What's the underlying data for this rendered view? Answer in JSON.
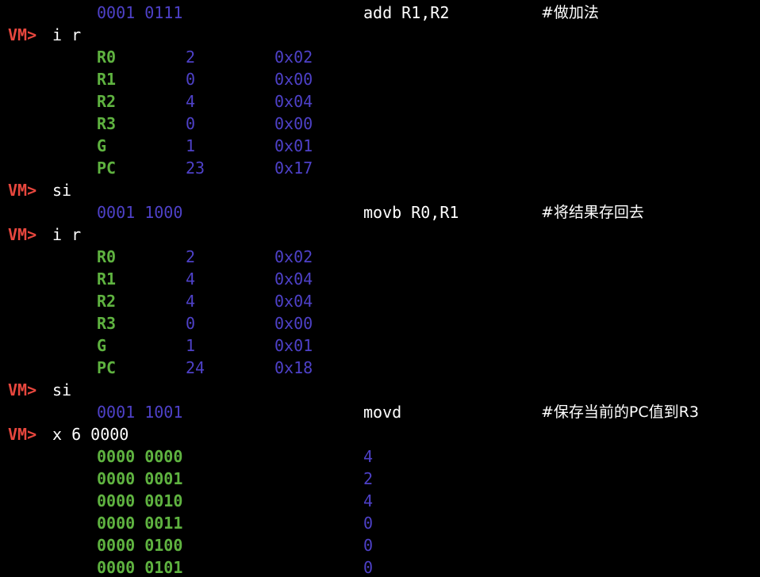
{
  "colors": {
    "background": "#000000",
    "prompt": "#e8473e",
    "register": "#5fb340",
    "value": "#4e41c8",
    "text": "#ffffff"
  },
  "terminal": {
    "prompt": "VM>",
    "lines": [
      {
        "kind": "instr",
        "bits": "0001 0111",
        "asm": "add R1,R2",
        "comment": "#做加法"
      },
      {
        "kind": "cmd",
        "text": "i r"
      },
      {
        "kind": "reg",
        "name": "R0",
        "dec": "2",
        "hex": "0x02"
      },
      {
        "kind": "reg",
        "name": "R1",
        "dec": "0",
        "hex": "0x00"
      },
      {
        "kind": "reg",
        "name": "R2",
        "dec": "4",
        "hex": "0x04"
      },
      {
        "kind": "reg",
        "name": "R3",
        "dec": "0",
        "hex": "0x00"
      },
      {
        "kind": "reg",
        "name": "G",
        "dec": "1",
        "hex": "0x01"
      },
      {
        "kind": "reg",
        "name": "PC",
        "dec": "23",
        "hex": "0x17"
      },
      {
        "kind": "cmd",
        "text": "si"
      },
      {
        "kind": "instr",
        "bits": "0001 1000",
        "asm": "movb R0,R1",
        "comment": "#将结果存回去"
      },
      {
        "kind": "cmd",
        "text": "i r"
      },
      {
        "kind": "reg",
        "name": "R0",
        "dec": "2",
        "hex": "0x02"
      },
      {
        "kind": "reg",
        "name": "R1",
        "dec": "4",
        "hex": "0x04"
      },
      {
        "kind": "reg",
        "name": "R2",
        "dec": "4",
        "hex": "0x04"
      },
      {
        "kind": "reg",
        "name": "R3",
        "dec": "0",
        "hex": "0x00"
      },
      {
        "kind": "reg",
        "name": "G",
        "dec": "1",
        "hex": "0x01"
      },
      {
        "kind": "reg",
        "name": "PC",
        "dec": "24",
        "hex": "0x18"
      },
      {
        "kind": "cmd",
        "text": "si"
      },
      {
        "kind": "instr",
        "bits": "0001 1001",
        "asm": "movd",
        "comment": "#保存当前的PC值到R3"
      },
      {
        "kind": "cmd",
        "text": "x 6 0000"
      },
      {
        "kind": "mem",
        "addr": "0000 0000",
        "value": "4"
      },
      {
        "kind": "mem",
        "addr": "0000 0001",
        "value": "2"
      },
      {
        "kind": "mem",
        "addr": "0000 0010",
        "value": "4"
      },
      {
        "kind": "mem",
        "addr": "0000 0011",
        "value": "0"
      },
      {
        "kind": "mem",
        "addr": "0000 0100",
        "value": "0"
      },
      {
        "kind": "mem",
        "addr": "0000 0101",
        "value": "0"
      }
    ]
  }
}
